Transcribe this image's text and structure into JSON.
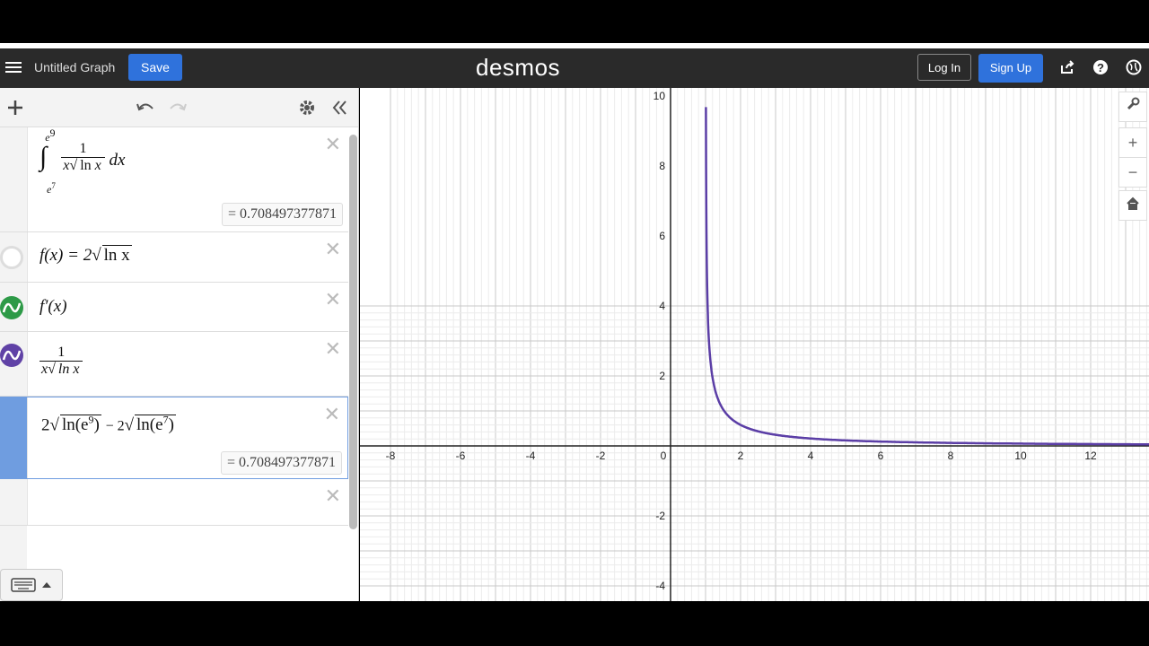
{
  "header": {
    "graph_title": "Untitled Graph",
    "save_label": "Save",
    "logo": "desmos",
    "login_label": "Log In",
    "signup_label": "Sign Up",
    "icons": [
      "share-icon",
      "help-icon",
      "globe-icon"
    ]
  },
  "toolbar": {
    "icons": [
      "add-icon",
      "undo-icon",
      "redo-icon",
      "gear-icon",
      "collapse-icon"
    ]
  },
  "expressions": [
    {
      "id": 1,
      "text": "∫ from e^7 to e^9 of 1/(x√(ln x)) dx",
      "lower": "e7",
      "upper": "e9",
      "result": "= 0.708497377871"
    },
    {
      "id": 2,
      "lhs": "f(x) = 2",
      "rad": "ln x",
      "color": "hidden"
    },
    {
      "id": 3,
      "text": "f′(x)",
      "color": "#2d9a47"
    },
    {
      "id": 4,
      "num": "1",
      "den_x": "x",
      "den_rad": "ln x",
      "color": "#6042a6"
    },
    {
      "id": 5,
      "part_a": "2",
      "part_a_rad": "ln(e",
      "part_a_exp": "9",
      "minus": "− 2",
      "part_b_rad": "ln(e",
      "part_b_exp": "7",
      "result": "= 0.708497377871"
    },
    {
      "id": 6,
      "text": ""
    }
  ],
  "graph": {
    "x_ticks": [
      "-8",
      "-6",
      "-4",
      "-2",
      "0",
      "2",
      "4",
      "6",
      "8",
      "10",
      "12"
    ],
    "y_ticks": [
      "10",
      "8",
      "6",
      "4",
      "2",
      "-2",
      "-4"
    ],
    "curve_color": "#5b3ea6",
    "tool_icons": [
      "wrench-icon",
      "zoom-in-icon",
      "zoom-out-icon",
      "home-icon"
    ]
  }
}
